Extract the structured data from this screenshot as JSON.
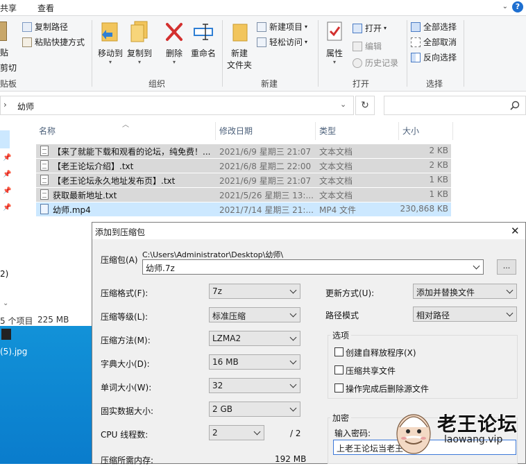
{
  "ribbon": {
    "tabs": [
      "共享",
      "查看"
    ],
    "clipboard": {
      "copy_path": "复制路径",
      "paste_shortcut": "粘贴快捷方式",
      "paste": "贴",
      "cut": "剪切",
      "group": "贴板"
    },
    "organize": {
      "move_to": "移动到",
      "copy_to": "复制到",
      "delete": "删除",
      "rename": "重命名",
      "group": "组织"
    },
    "new": {
      "new_item": "新建项目",
      "easy_access": "轻松访问",
      "new_folder_line1": "新建",
      "new_folder_line2": "文件夹",
      "group": "新建"
    },
    "open": {
      "properties": "属性",
      "open": "打开",
      "edit": "编辑",
      "history": "历史记录",
      "group": "打开"
    },
    "select": {
      "select_all": "全部选择",
      "select_none": "全部取消",
      "invert": "反向选择",
      "group": "选择"
    }
  },
  "address": {
    "path": "幼师"
  },
  "columns": {
    "name": "名称",
    "date": "修改日期",
    "type": "类型",
    "size": "大小"
  },
  "files": [
    {
      "name": "【来了就能下载和观看的论坛，纯免费！...",
      "date": "2021/6/9 星期三 21:07",
      "type": "文本文档",
      "size": "2 KB"
    },
    {
      "name": "【老王论坛介绍】.txt",
      "date": "2021/6/8 星期二 22:00",
      "type": "文本文档",
      "size": "2 KB"
    },
    {
      "name": "【老王论坛永久地址发布页】.txt",
      "date": "2021/6/9 星期三 21:07",
      "type": "文本文档",
      "size": "1 KB"
    },
    {
      "name": "获取最新地址.txt",
      "date": "2021/5/26 星期三 13:...",
      "type": "文本文档",
      "size": "1 KB"
    },
    {
      "name": "幼师.mp4",
      "date": "2021/7/14 星期三 21:...",
      "type": "MP4 文件",
      "size": "230,868 KB"
    }
  ],
  "nav": {
    "count_label": "2)"
  },
  "status": {
    "items": "5 个项目",
    "size": "225 MB"
  },
  "desktop": {
    "file_label": "(5).jpg"
  },
  "dialog": {
    "title": "添加到压缩包",
    "archive_label": "压缩包(A)",
    "archive_dir": "C:\\Users\\Administrator\\Desktop\\幼师\\",
    "archive_name": "幼师.7z",
    "browse": "...",
    "rows": [
      {
        "label": "压缩格式(F):",
        "value": "7z"
      },
      {
        "label": "压缩等级(L):",
        "value": "标准压缩"
      },
      {
        "label": "压缩方法(M):",
        "value": "LZMA2"
      },
      {
        "label": "字典大小(D):",
        "value": "16 MB"
      },
      {
        "label": "单词大小(W):",
        "value": "32"
      },
      {
        "label": "固实数据大小:",
        "value": "2 GB"
      }
    ],
    "threads_label": "CPU 线程数:",
    "threads_value": "2",
    "threads_total": "/ 2",
    "memory_label": "压缩所需内存:",
    "memory_value": "192 MB",
    "update_label": "更新方式(U):",
    "update_value": "添加并替换文件",
    "path_label": "路径模式",
    "path_value": "相对路径",
    "options_title": "选项",
    "options": [
      "创建自释放程序(X)",
      "压缩共享文件",
      "操作完成后删除源文件"
    ],
    "encrypt_title": "加密",
    "password_label": "输入密码:",
    "password_value": "上老王论坛当老王"
  },
  "watermark": {
    "title": "老王论坛",
    "url": "laowang.vip"
  },
  "colors": {
    "selection": "#cce8ff",
    "desktop": "#0a7ccc",
    "accent": "#1e6fd0"
  }
}
